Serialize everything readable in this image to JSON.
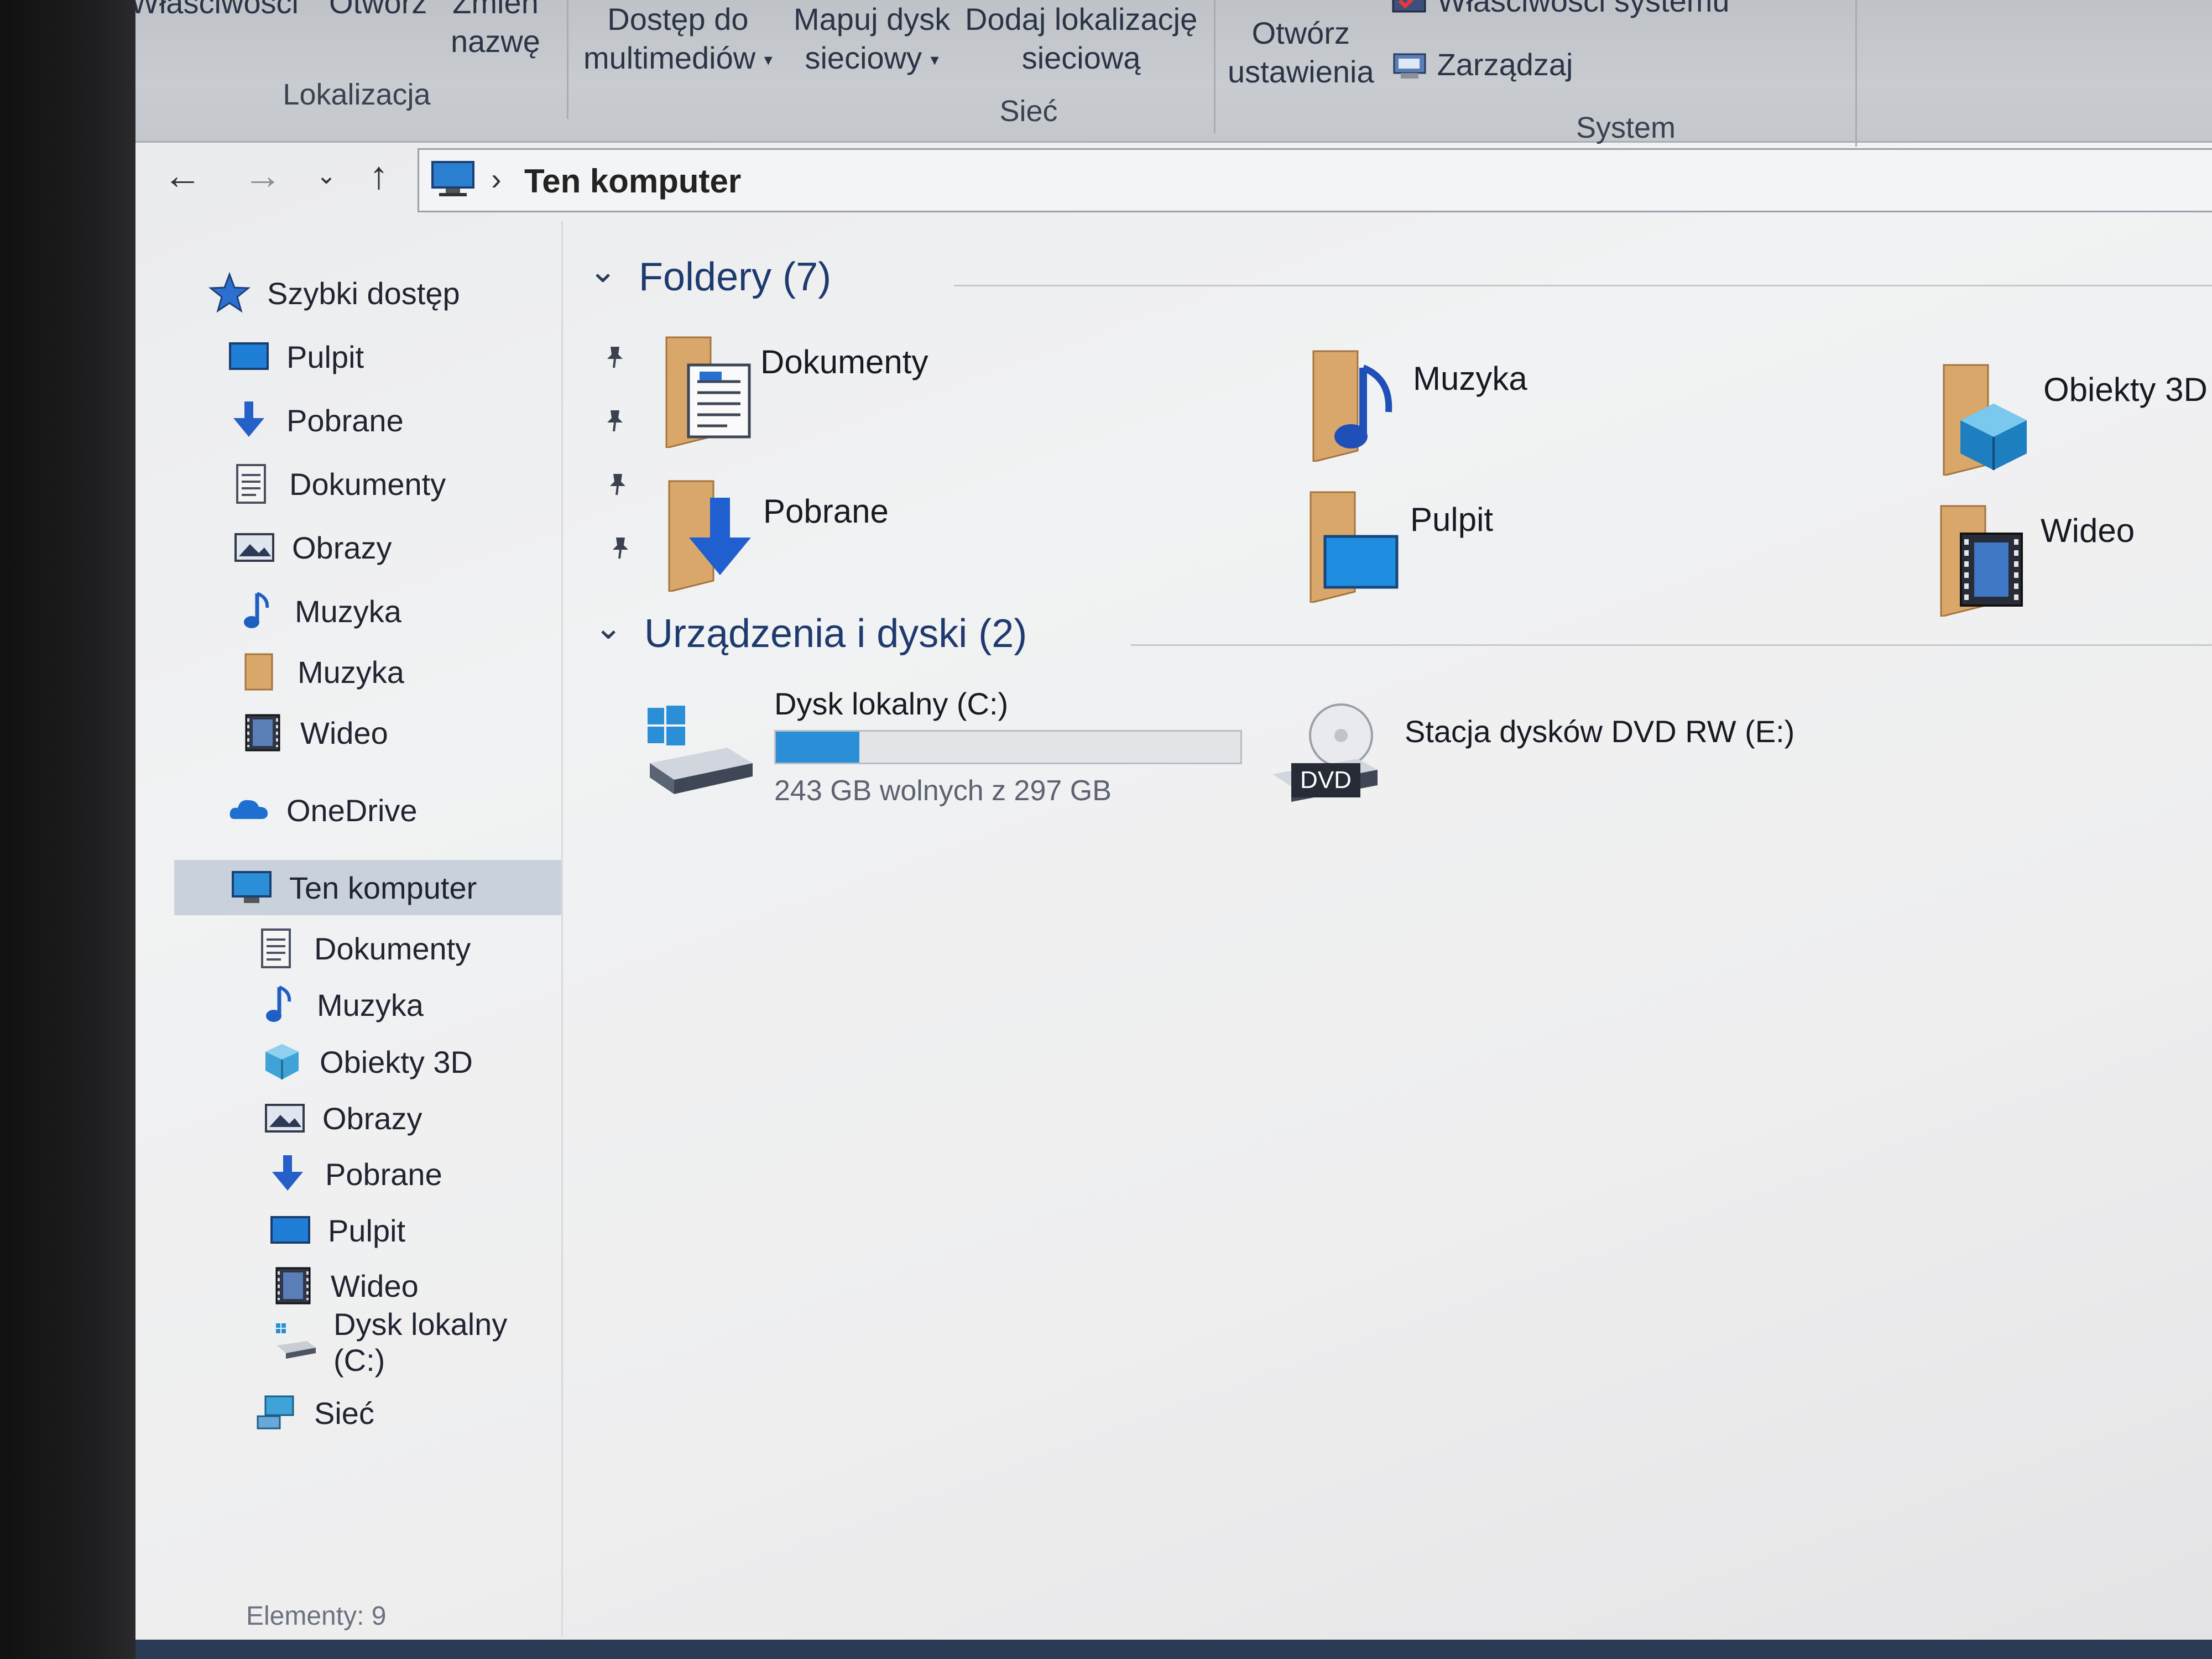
{
  "ribbon": {
    "buttons": {
      "properties": "Właściwości",
      "open": "Otwórz",
      "rename_line1": "Zmień",
      "rename_line2": "nazwę",
      "media_access_line1": "Dostęp do",
      "media_access_line2": "multimediów",
      "map_drive_line1": "Mapuj dysk",
      "map_drive_line2": "sieciowy",
      "add_location_line1": "Dodaj lokalizację",
      "add_location_line2": "sieciową",
      "open_settings_line1": "Otwórz",
      "open_settings_line2": "ustawienia",
      "system_properties": "Właściwości systemu",
      "manage": "Zarządzaj"
    },
    "groups": {
      "location": "Lokalizacja",
      "network": "Sieć",
      "system": "System"
    }
  },
  "address": {
    "crumb": "Ten komputer"
  },
  "sidebar": {
    "quick_access": "Szybki dostęp",
    "quick_items": [
      {
        "label": "Pulpit",
        "icon": "desktop-icon",
        "pinned": true
      },
      {
        "label": "Pobrane",
        "icon": "download-icon",
        "pinned": true
      },
      {
        "label": "Dokumenty",
        "icon": "document-icon",
        "pinned": true
      },
      {
        "label": "Obrazy",
        "icon": "pictures-icon",
        "pinned": true
      },
      {
        "label": "Muzyka",
        "icon": "music-icon",
        "pinned": false
      },
      {
        "label": "Muzyka",
        "icon": "folder-icon",
        "pinned": false
      },
      {
        "label": "Wideo",
        "icon": "video-icon",
        "pinned": false
      }
    ],
    "onedrive": "OneDrive",
    "this_pc": "Ten komputer",
    "pc_items": [
      {
        "label": "Dokumenty",
        "icon": "document-icon"
      },
      {
        "label": "Muzyka",
        "icon": "music-icon"
      },
      {
        "label": "Obiekty 3D",
        "icon": "3d-objects-icon"
      },
      {
        "label": "Obrazy",
        "icon": "pictures-icon"
      },
      {
        "label": "Pobrane",
        "icon": "download-icon"
      },
      {
        "label": "Pulpit",
        "icon": "desktop-icon"
      },
      {
        "label": "Wideo",
        "icon": "video-icon"
      },
      {
        "label": "Dysk lokalny (C:)",
        "icon": "local-disk-icon"
      }
    ],
    "network": "Sieć"
  },
  "content": {
    "folders_title": "Foldery (7)",
    "folders": [
      {
        "label": "Dokumenty",
        "icon": "documents-folder-icon"
      },
      {
        "label": "Muzyka",
        "icon": "music-folder-icon"
      },
      {
        "label": "Obiekty 3D",
        "icon": "3d-objects-folder-icon"
      },
      {
        "label": "Pobrane",
        "icon": "downloads-folder-icon"
      },
      {
        "label": "Pulpit",
        "icon": "desktop-folder-icon"
      },
      {
        "label": "Wideo",
        "icon": "video-folder-icon"
      }
    ],
    "devices_title": "Urządzenia i dyski (2)",
    "drives": [
      {
        "label": "Dysk lokalny (C:)",
        "free_text": "243 GB wolnych z 297 GB",
        "used_fraction": 0.18
      },
      {
        "label": "Stacja dysków DVD RW (E:)",
        "badge": "DVD"
      }
    ]
  },
  "status": {
    "items": "Elementy: 9"
  },
  "colors": {
    "accent": "#2a8fd6",
    "folder": "#d9a76a",
    "section_title": "#1e3a6e"
  }
}
